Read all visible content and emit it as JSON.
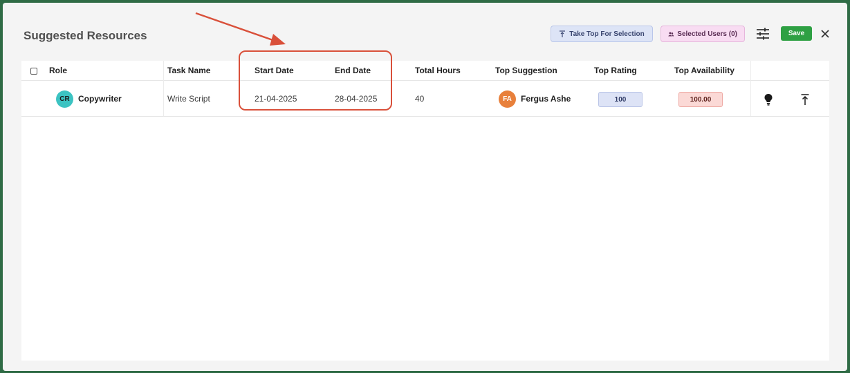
{
  "modal": {
    "title": "Suggested Resources",
    "take_top_label": "Take Top For Selection",
    "selected_users_label": "Selected Users (0)",
    "save_label": "Save"
  },
  "table": {
    "headers": {
      "role": "Role",
      "task_name": "Task Name",
      "start_date": "Start Date",
      "end_date": "End Date",
      "total_hours": "Total Hours",
      "top_suggestion": "Top Suggestion",
      "top_rating": "Top Rating",
      "top_availability": "Top Availability"
    },
    "rows": [
      {
        "role_initials": "CR",
        "role": "Copywriter",
        "task_name": "Write Script",
        "start_date": "21-04-2025",
        "end_date": "28-04-2025",
        "total_hours": "40",
        "suggestion_initials": "FA",
        "top_suggestion": "Fergus Ashe",
        "top_rating": "100",
        "top_availability": "100.00"
      }
    ]
  },
  "icons": {
    "take_top": "vertical-align-top-icon",
    "selected_users": "users-icon",
    "filters": "tune-sliders-icon",
    "close": "close-icon",
    "suggest": "lightbulb-icon",
    "take_top_row": "vertical-align-top-icon"
  },
  "colors": {
    "save": "#2ea043",
    "annotation": "#d9503a",
    "role_avatar": "#3cc3c2",
    "suggestion_avatar": "#e8803b",
    "rating_badge": "#dde3f6",
    "availability_badge": "#fbd9d6"
  }
}
